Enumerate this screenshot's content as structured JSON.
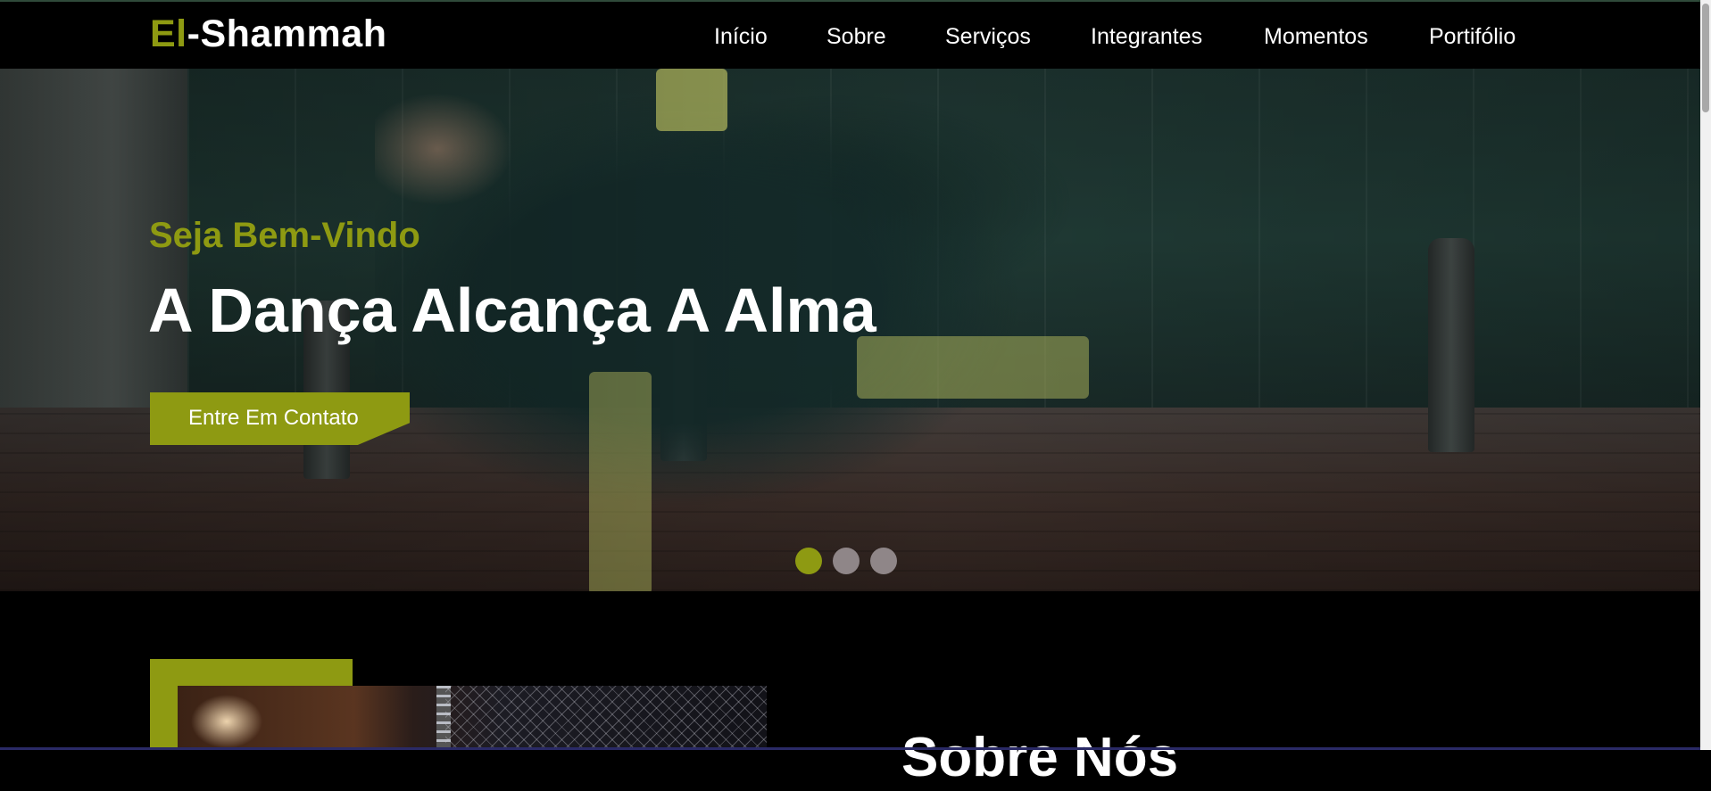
{
  "navbar": {
    "logo": {
      "accent": "El",
      "rest": "-Shammah"
    },
    "items": [
      {
        "label": "Início"
      },
      {
        "label": "Sobre"
      },
      {
        "label": "Serviços"
      },
      {
        "label": "Integrantes"
      },
      {
        "label": "Momentos"
      },
      {
        "label": "Portifólio"
      }
    ]
  },
  "hero": {
    "subtitle": "Seja Bem-Vindo",
    "title": "A Dança Alcança A Alma",
    "button_label": "Entre Em Contato",
    "slides_total": 3,
    "active_slide": 1
  },
  "about": {
    "title": "Sobre Nós"
  },
  "colors": {
    "accent": "#8e9a12",
    "background": "#000000",
    "text": "#ffffff",
    "inactive_dot": "#8f8688"
  }
}
